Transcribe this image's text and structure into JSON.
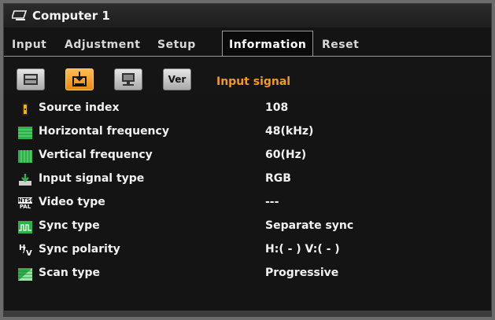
{
  "window": {
    "title": "Computer 1",
    "title_icon": "computer-window-icon"
  },
  "tabs": [
    {
      "label": "Input",
      "active": false
    },
    {
      "label": "Adjustment",
      "active": false
    },
    {
      "label": "Setup",
      "active": false
    },
    {
      "label": "Information",
      "active": true
    },
    {
      "label": "Reset",
      "active": false
    }
  ],
  "subpages": [
    {
      "icon": "usage-time-icon",
      "active": false
    },
    {
      "icon": "input-signal-icon",
      "active": true
    },
    {
      "icon": "lan-settings-icon",
      "active": false
    },
    {
      "label": "Ver",
      "icon": "version-icon",
      "active": false
    }
  ],
  "subpage_title": "Input signal",
  "rows": [
    {
      "label": "Source index",
      "value": "108",
      "icon": "source-index-icon"
    },
    {
      "label": "Horizontal frequency",
      "value": "48(kHz)",
      "icon": "horizontal-frequency-icon"
    },
    {
      "label": "Vertical frequency",
      "value": "60(Hz)",
      "icon": "vertical-frequency-icon"
    },
    {
      "label": "Input signal type",
      "value": "RGB",
      "icon": "input-signal-type-icon"
    },
    {
      "label": "Video type",
      "value": "---",
      "icon": "ntsc-pal-icon",
      "icon_text_top": "NTSC",
      "icon_text_bottom": "PAL"
    },
    {
      "label": "Sync type",
      "value": "Separate sync",
      "icon": "sync-type-icon"
    },
    {
      "label": "Sync polarity",
      "value": "H:( - ) V:( - )",
      "icon": "sync-polarity-icon",
      "icon_text_top": "H",
      "icon_text_bottom": "V"
    },
    {
      "label": "Scan type",
      "value": "Progressive",
      "icon": "scan-type-icon"
    }
  ],
  "colors": {
    "accent": "#f39a1f",
    "icon_green": "#2fb04a",
    "background": "#141414"
  }
}
